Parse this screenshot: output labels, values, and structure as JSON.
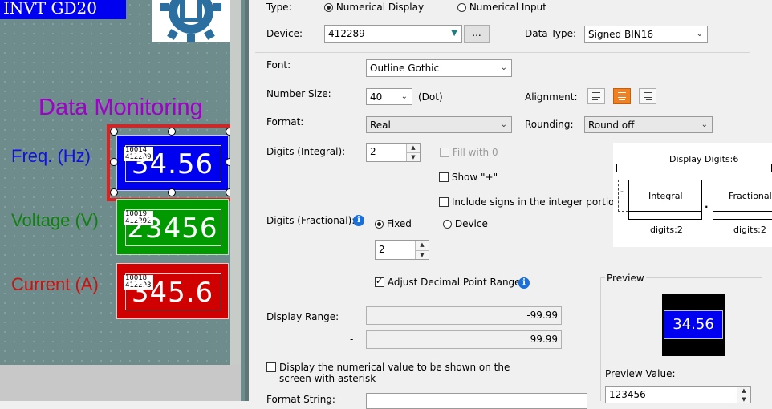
{
  "canvas": {
    "banner_title": "INVT GD20",
    "monitor_title": "Data Monitoring",
    "signals": [
      {
        "label": "Freq. (Hz)",
        "value": "34.56",
        "tag_top": "10014",
        "tag_bottom": "412289",
        "label_color": "#1010e0",
        "box_color": "#0000f0"
      },
      {
        "label": "Voltage (V)",
        "value": "23456",
        "tag_top": "10019",
        "tag_bottom": "412292",
        "label_color": "#108010",
        "box_color": "#009a00"
      },
      {
        "label": "Current (A)",
        "value": "345.6",
        "tag_top": "10018",
        "tag_bottom": "412293",
        "label_color": "#d01010",
        "box_color": "#d00000"
      }
    ]
  },
  "dialog": {
    "type_label": "Type:",
    "type_options": [
      "Numerical Display",
      "Numerical Input"
    ],
    "type_selected": "Numerical Display",
    "device_label": "Device:",
    "device_value": "412289",
    "browse_label": "...",
    "data_type_label": "Data Type:",
    "data_type_value": "Signed BIN16",
    "font_label": "Font:",
    "font_value": "Outline Gothic",
    "number_size_label": "Number Size:",
    "number_size_value": "40",
    "number_size_unit": "(Dot)",
    "alignment_label": "Alignment:",
    "alignment_selected": "center",
    "format_label": "Format:",
    "format_value": "Real",
    "rounding_label": "Rounding:",
    "rounding_value": "Round off",
    "digits_integral_label": "Digits (Integral):",
    "digits_integral_value": "2",
    "fill_with_0": "Fill with 0",
    "show_plus": "Show \"+\"",
    "include_signs": "Include signs in the integer portion",
    "digits_fractional_label": "Digits (Fractional):",
    "fractional_options": [
      "Fixed",
      "Device"
    ],
    "fractional_selected": "Fixed",
    "digits_fractional_value": "2",
    "adjust_decimal": "Adjust Decimal Point Range",
    "adjust_decimal_checked": true,
    "display_range_label": "Display Range:",
    "range_min": "-99.99",
    "range_dash": "-",
    "range_max": "99.99",
    "asterisk_label": "Display the numerical value to be shown on the screen with asterisk",
    "format_string_label": "Format String:",
    "digits_diagram": {
      "title": "Display Digits:6",
      "sign": "-",
      "integral": "Integral",
      "dot": ".",
      "fractional": "Fractional",
      "integral_count": "digits:2",
      "fractional_count": "digits:2"
    },
    "preview": {
      "group_label": "Preview",
      "value": "34.56",
      "preview_value_label": "Preview Value:",
      "preview_value": "123456"
    }
  }
}
